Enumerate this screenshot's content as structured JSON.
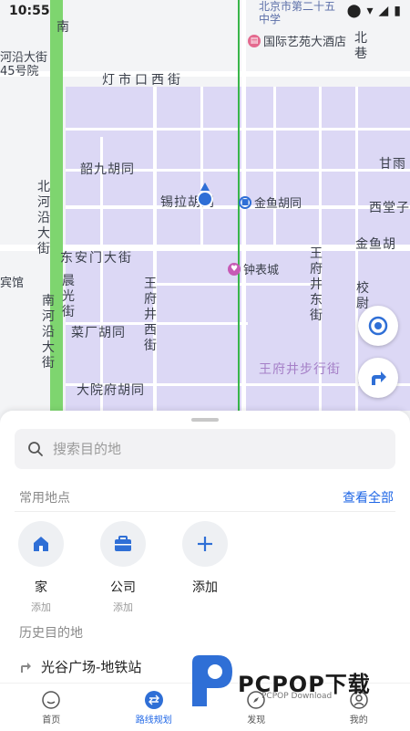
{
  "status_bar": {
    "time": "10:55"
  },
  "map": {
    "labels": {
      "dengshikou": "灯市口西街",
      "shaojiu": "韶九胡同",
      "xila": "锡拉胡同",
      "jinyu": "金鱼胡同",
      "jinyu2": "金鱼胡",
      "xitangzi": "西堂子",
      "ganyu": "甘雨",
      "donganmen": "东安门大街",
      "caichang": "菜厂胡同",
      "dayuanfu": "大院府胡同",
      "wangfujing_west": "王府井西街",
      "wangfujing_east": "王府井东街",
      "wangfujing_walk": "王府井步行街",
      "beiheyan": "北河沿大街",
      "nanheyan": "南河沿大街",
      "chenguang": "晨光街",
      "xiaowei": "校尉",
      "heyan_top": "河沿大街",
      "no45": "45号院",
      "beixiang": "北巷",
      "nan": "南",
      "binguan": "宾馆",
      "beijing_school": "北京市第二十五中学"
    },
    "pois": {
      "hotel": "国际艺苑大酒店",
      "subway": "金鱼胡同",
      "clock": "钟表城"
    },
    "colors": {
      "block": "#dcd8f5",
      "green": "#7ed56f",
      "accent": "#1e66e6"
    }
  },
  "panel": {
    "search_placeholder": "搜索目的地",
    "common_places": {
      "title": "常用地点",
      "view_all": "查看全部"
    },
    "places": [
      {
        "name": "家",
        "sub": "添加",
        "icon": "home-icon"
      },
      {
        "name": "公司",
        "sub": "添加",
        "icon": "briefcase-icon"
      },
      {
        "name": "添加",
        "sub": "",
        "icon": "plus-icon"
      }
    ],
    "history": {
      "title": "历史目的地",
      "items": [
        "光谷广场-地铁站"
      ]
    }
  },
  "tabs": [
    {
      "label": "首页",
      "icon": "home-smile-icon",
      "active": false
    },
    {
      "label": "路线规划",
      "icon": "route-icon",
      "active": true
    },
    {
      "label": "发现",
      "icon": "compass-icon",
      "active": false
    },
    {
      "label": "我的",
      "icon": "user-icon",
      "active": false
    }
  ],
  "watermark": {
    "brand": "PCPOP下载",
    "sub": "PCPOP Download"
  }
}
